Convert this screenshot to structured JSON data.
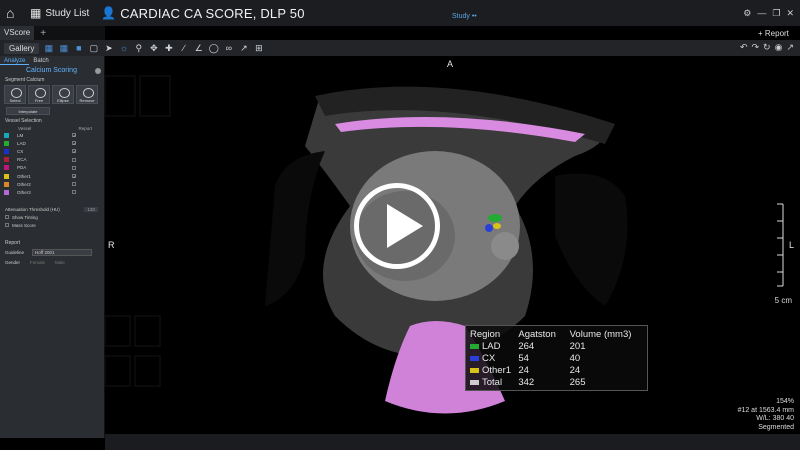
{
  "titlebar": {
    "study_list": "Study List",
    "title": "CARDIAC CA SCORE, DLP 50",
    "study_menu": "Study ••",
    "report": "+ Report"
  },
  "tabs": {
    "app_tab": "VScore",
    "add": "+"
  },
  "toolbar": {
    "gallery": "Gallery"
  },
  "panel": {
    "subtabs": [
      "Analyze",
      "Batch"
    ],
    "calc_title": "Calcium Scoring",
    "segment_label": "Segment Calcium",
    "seg_tools": [
      "Select",
      "Free",
      "Ellipse",
      "Remove"
    ],
    "interpolate": "Interpolate",
    "vessel_selection": "Vessel Selection",
    "vessel_header": [
      "Vessel",
      "Report"
    ],
    "vessels": [
      {
        "name": "LM",
        "color": "#19a8b8",
        "report": "✓"
      },
      {
        "name": "LAD",
        "color": "#22aa33",
        "report": "✓"
      },
      {
        "name": "CX",
        "color": "#1a2fcc",
        "report": "✓"
      },
      {
        "name": "RCA",
        "color": "#b01f3a",
        "report": ""
      },
      {
        "name": "PDA",
        "color": "#c0187a",
        "report": ""
      },
      {
        "name": "Other1",
        "color": "#d8c21a",
        "report": "✓"
      },
      {
        "name": "Other2",
        "color": "#d8882a",
        "report": ""
      },
      {
        "name": "Other3",
        "color": "#b46ad6",
        "report": ""
      }
    ],
    "attenuation_label": "Attenuation Threshold (HU)",
    "attenuation_value": "130",
    "show_tinting": "Show Tinting",
    "mass_score": "Mass Score",
    "report_label": "Report",
    "guideline_label": "Guideline",
    "guideline_value": "Hoff 2001",
    "gender_label": "Gender",
    "female": "Female",
    "male": "Male"
  },
  "viewport": {
    "label_top": "A",
    "label_left": "R",
    "label_right": "L",
    "scale": "5 cm",
    "info": [
      "154%",
      "#12 at 1563.4 mm",
      "W/L: 380 40",
      "Segmented"
    ]
  },
  "legend": {
    "header": [
      "Region",
      "Agatston",
      "Volume (mm3)"
    ],
    "rows": [
      {
        "region": "LAD",
        "agatston": "264",
        "volume": "201",
        "color": "#22aa33"
      },
      {
        "region": "CX",
        "agatston": "54",
        "volume": "40",
        "color": "#2a3fd8"
      },
      {
        "region": "Other1",
        "agatston": "24",
        "volume": "24",
        "color": "#d8c21a"
      },
      {
        "region": "Total",
        "agatston": "342",
        "volume": "265",
        "color": "#cccccc"
      }
    ]
  }
}
